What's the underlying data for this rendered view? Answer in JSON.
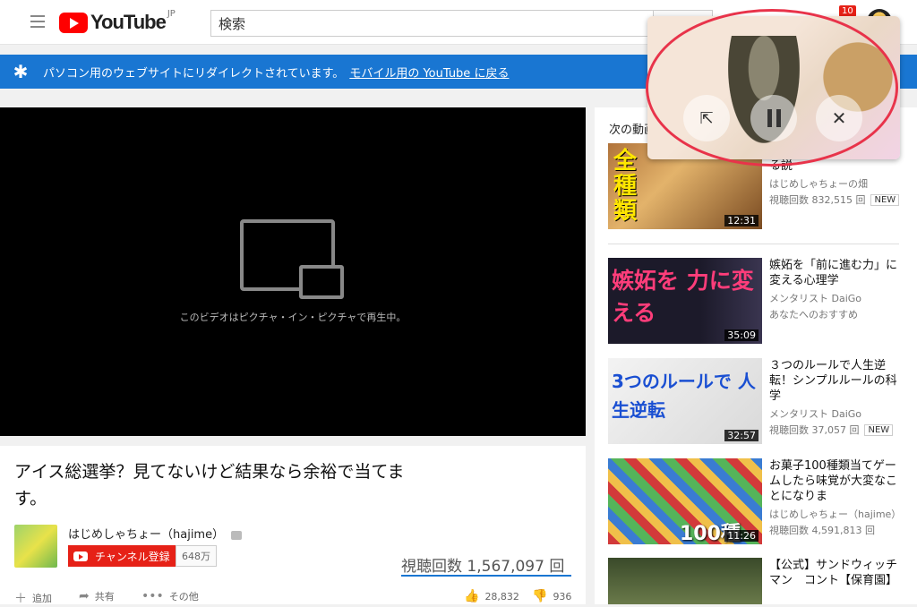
{
  "header": {
    "logo_text": "YouTube",
    "logo_region": "JP",
    "search_placeholder": "検索",
    "notification_count": "10"
  },
  "banner": {
    "text": "パソコン用のウェブサイトにリダイレクトされています。",
    "link": "モバイル用の YouTube に戻る"
  },
  "player": {
    "pip_message": "このビデオはピクチャ・イン・ピクチャで再生中。"
  },
  "video": {
    "title": "アイス総選挙？見てないけど結果なら余裕で当てます。",
    "channel": "はじめしゃちょー（hajime）",
    "subscribe_label": "チャンネル登録",
    "subscriber_count": "648万",
    "views": "視聴回数 1,567,097 回",
    "actions": {
      "add": "追加",
      "share": "共有",
      "more": "その他",
      "likes": "28,832",
      "dislikes": "936"
    }
  },
  "sidebar": {
    "header": "次の動画",
    "items": [
      {
        "title": "寄付すれば無限に食べれる説",
        "channel": "はじめしゃちょーの畑",
        "views": "視聴回数 832,515 回",
        "badge": "NEW",
        "duration": "12:31",
        "thumb_text": "全種類"
      },
      {
        "title": "嫉妬を「前に進む力」に変える心理学",
        "channel": "メンタリスト DaiGo",
        "views": "あなたへのおすすめ",
        "badge": "",
        "duration": "35:09",
        "thumb_text": "嫉妬を 力に変える"
      },
      {
        "title": "３つのルールで人生逆転！シンプルルールの科学",
        "channel": "メンタリスト DaiGo",
        "views": "視聴回数 37,057 回",
        "badge": "NEW",
        "duration": "32:57",
        "thumb_text": "3つのルールで 人生逆転"
      },
      {
        "title": "お菓子100種類当てゲームしたら味覚が大変なことになりま",
        "channel": "はじめしゃちょー（hajime）",
        "views": "視聴回数 4,591,813 回",
        "badge": "",
        "duration": "11:26",
        "thumb_text": "100種"
      },
      {
        "title": "【公式】サンドウィッチマン　コント【保育園】",
        "channel": "",
        "views": "",
        "badge": "",
        "duration": "",
        "thumb_text": ""
      }
    ]
  }
}
